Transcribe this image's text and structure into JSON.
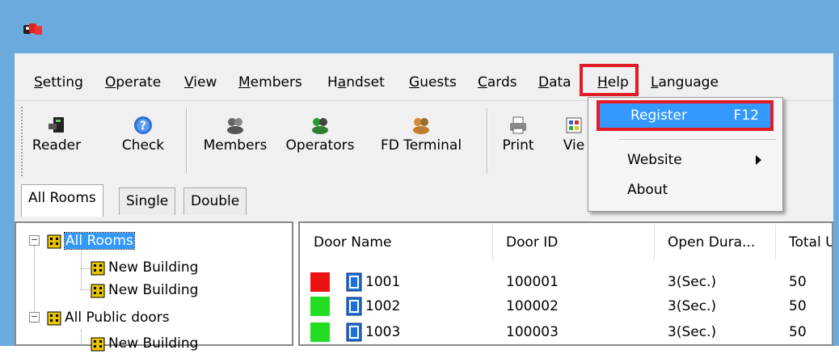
{
  "menu": {
    "items": [
      {
        "pre": "",
        "u": "S",
        "post": "etting"
      },
      {
        "pre": "",
        "u": "O",
        "post": "perate"
      },
      {
        "pre": "",
        "u": "V",
        "post": "iew"
      },
      {
        "pre": "",
        "u": "M",
        "post": "embers"
      },
      {
        "pre": "H",
        "u": "a",
        "post": "ndset"
      },
      {
        "pre": "",
        "u": "G",
        "post": "uests"
      },
      {
        "pre": "",
        "u": "C",
        "post": "ards"
      },
      {
        "pre": "",
        "u": "D",
        "post": "ata"
      },
      {
        "pre": "",
        "u": "H",
        "post": "elp"
      },
      {
        "pre": "",
        "u": "L",
        "post": "anguage"
      }
    ]
  },
  "toolbar": {
    "buttons": [
      {
        "label": "Reader",
        "icon": "card-reader-icon"
      },
      {
        "label": "Check",
        "icon": "question-icon"
      },
      {
        "label": "Members",
        "icon": "members-icon"
      },
      {
        "label": "Operators",
        "icon": "operators-icon"
      },
      {
        "label": "FD Terminal",
        "icon": "fd-terminal-icon"
      },
      {
        "label": "Print",
        "icon": "printer-icon"
      },
      {
        "label": "Vie",
        "icon": "view-icon"
      }
    ]
  },
  "help_menu": {
    "register_label": "Register",
    "register_shortcut": "F12",
    "website_label": "Website",
    "about_label": "About"
  },
  "tabs": [
    "All Rooms",
    "Single",
    "Double"
  ],
  "tree": {
    "nodes": [
      "All Rooms",
      "New Building",
      "New Building",
      "All Public doors",
      "New Building"
    ]
  },
  "door_list": {
    "columns": [
      "Door Name",
      "Door ID",
      "Open Dura...",
      "Total U"
    ],
    "rows": [
      {
        "status_color": "#ee1111",
        "name": "1001",
        "id": "100001",
        "open_duration": "3(Sec.)",
        "total": "50"
      },
      {
        "status_color": "#22dd22",
        "name": "1002",
        "id": "100002",
        "open_duration": "3(Sec.)",
        "total": "50"
      },
      {
        "status_color": "#22dd22",
        "name": "1003",
        "id": "100003",
        "open_duration": "3(Sec.)",
        "total": "50"
      }
    ]
  },
  "colors": {
    "accent": "#3399ff",
    "highlight_box": "#e31b23",
    "window_frame": "#6baadc"
  }
}
